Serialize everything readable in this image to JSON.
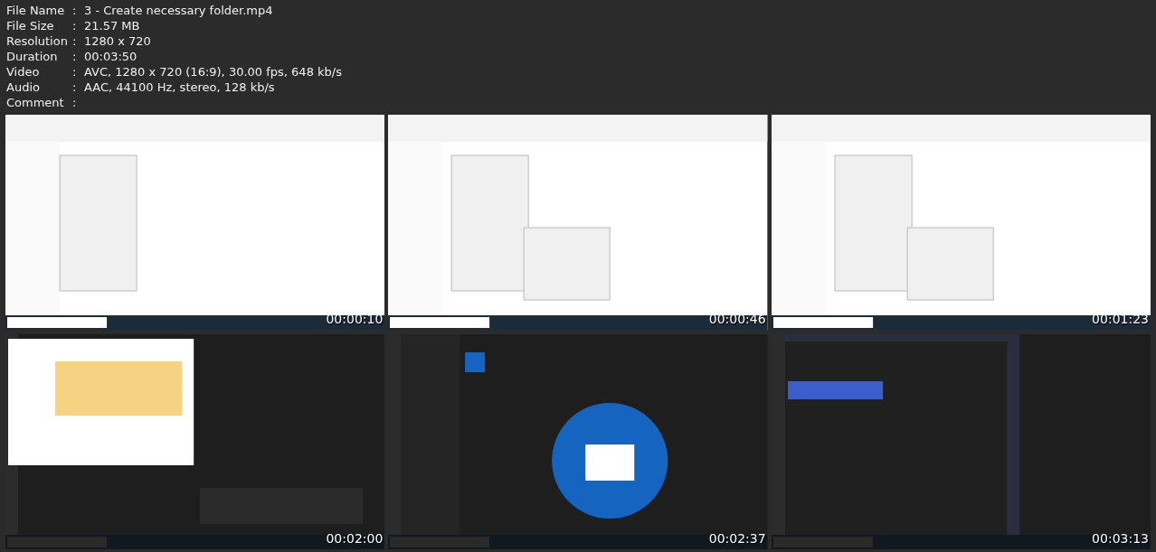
{
  "info": [
    {
      "label": "File Name",
      "sep": ":",
      "value": "3 - Create necessary folder.mp4"
    },
    {
      "label": "File Size",
      "sep": ":",
      "value": "21.57 MB"
    },
    {
      "label": "Resolution",
      "sep": ":",
      "value": "1280 x 720"
    },
    {
      "label": "Duration",
      "sep": ":",
      "value": "00:03:50"
    },
    {
      "label": "Video",
      "sep": ":",
      "value": "AVC, 1280 x 720 (16:9), 30.00 fps, 648 kb/s"
    },
    {
      "label": "Audio",
      "sep": ":",
      "value": "AAC, 44100 Hz, stereo, 128 kb/s"
    },
    {
      "label": "Comment",
      "sep": ":"
    }
  ],
  "thumbnails": [
    {
      "timestamp": "00:00:10"
    },
    {
      "timestamp": "00:00:46"
    },
    {
      "timestamp": "00:01:23"
    },
    {
      "timestamp": "00:02:00"
    },
    {
      "timestamp": "00:02:37"
    },
    {
      "timestamp": "00:03:13"
    }
  ]
}
